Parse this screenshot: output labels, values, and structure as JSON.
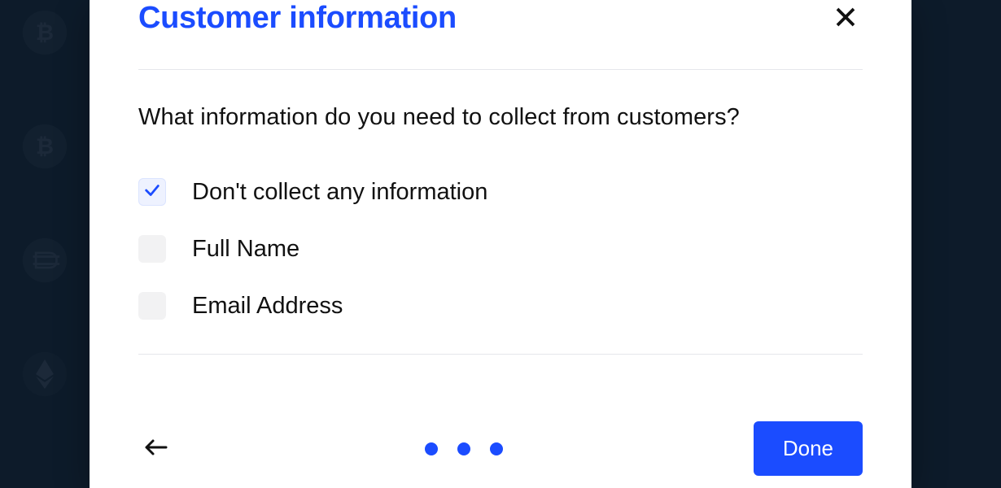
{
  "modal": {
    "title": "Customer information",
    "question": "What information do you need to collect from customers?",
    "options": [
      {
        "label": "Don't collect any information",
        "checked": true
      },
      {
        "label": "Full Name",
        "checked": false
      },
      {
        "label": "Email Address",
        "checked": false
      }
    ],
    "doneLabel": "Done"
  },
  "colors": {
    "accent": "#1b4cff",
    "background": "#0d1b2a"
  },
  "pager": {
    "steps": 3,
    "current": 3
  },
  "bg": {
    "icons": [
      "bitcoin-icon",
      "bitcoin-icon",
      "dai-icon",
      "ethereum-icon"
    ]
  }
}
